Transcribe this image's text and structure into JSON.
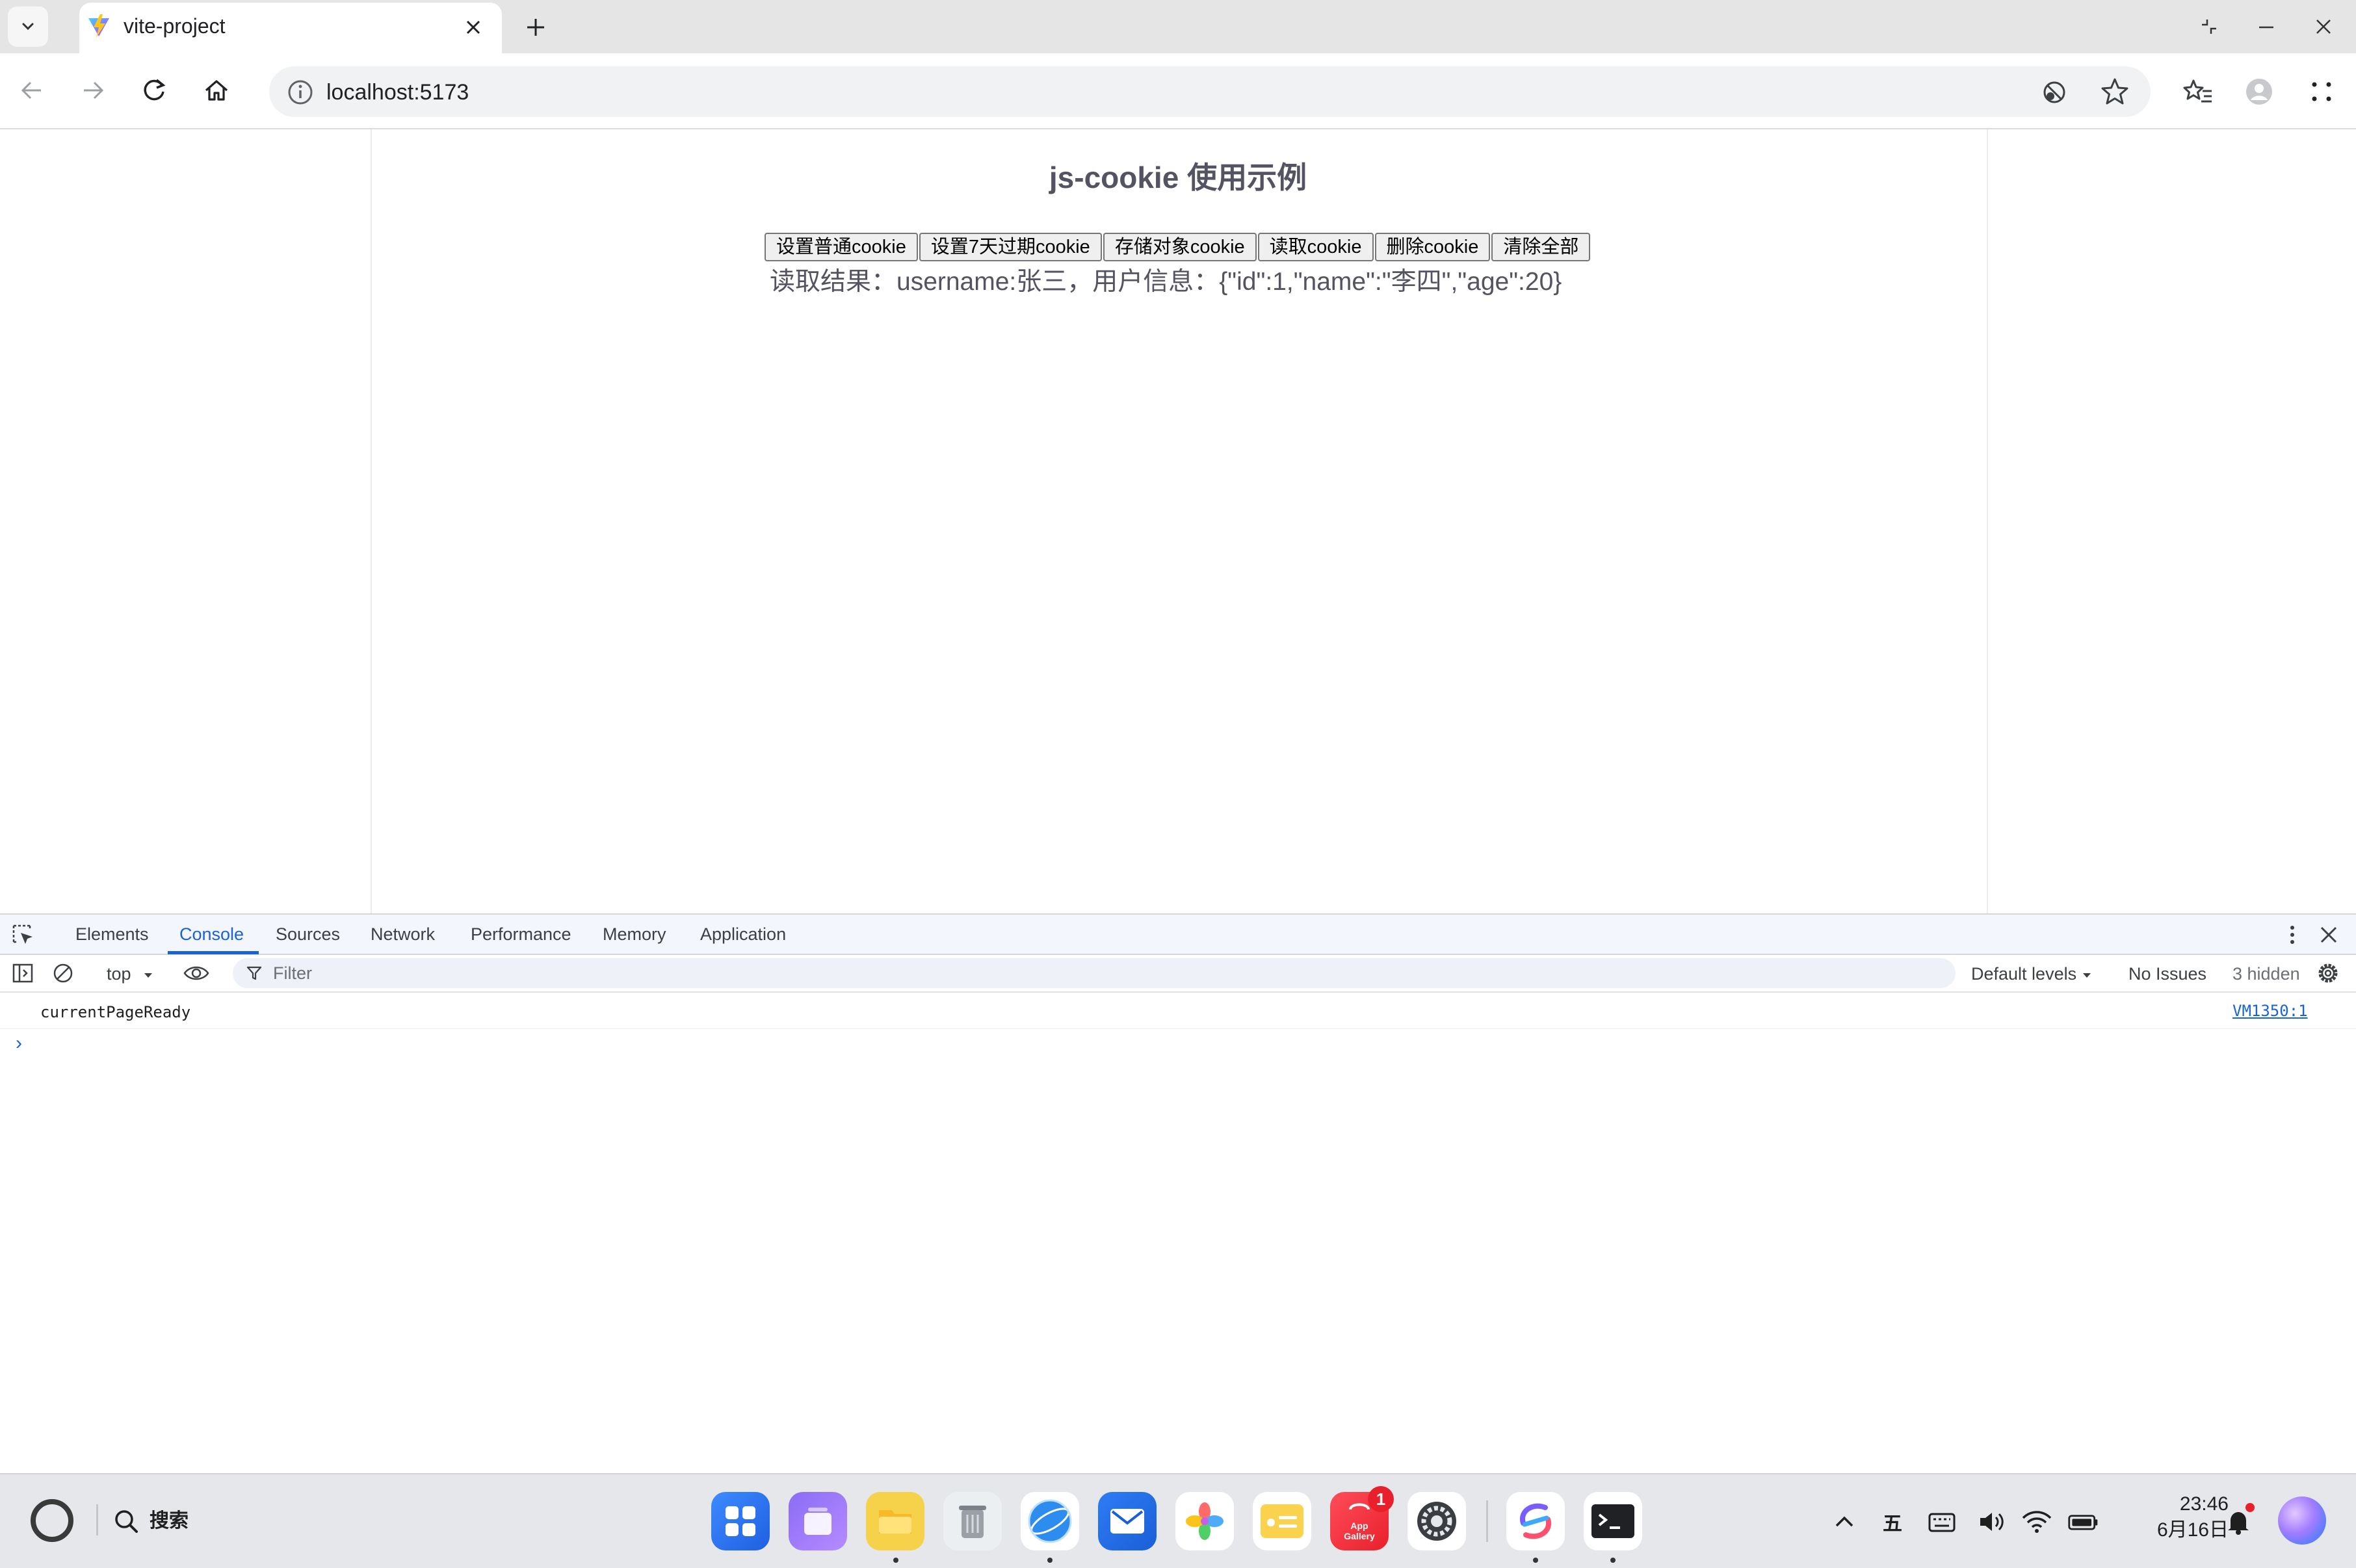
{
  "browser": {
    "tab_title": "vite-project",
    "url": "localhost:5173"
  },
  "page": {
    "heading": "js-cookie 使用示例",
    "buttons": [
      "设置普通cookie",
      "设置7天过期cookie",
      "存储对象cookie",
      "读取cookie",
      "删除cookie",
      "清除全部"
    ],
    "result_text": "读取结果：username:张三，用户信息：{\"id\":1,\"name\":\"李四\",\"age\":20}"
  },
  "devtools": {
    "tabs": [
      "Elements",
      "Console",
      "Sources",
      "Network",
      "Performance",
      "Memory",
      "Application"
    ],
    "active_tab": "Console",
    "context": "top",
    "filter_placeholder": "Filter",
    "levels": "Default levels",
    "issues": "No Issues",
    "hidden": "3 hidden",
    "messages": [
      {
        "text": "currentPageReady",
        "source": "VM1350:1"
      }
    ],
    "prompt": "›"
  },
  "taskbar": {
    "search_label": "搜索",
    "apps": [
      "launcher-icon",
      "multitask-icon",
      "files-icon",
      "trash-icon",
      "browser-icon",
      "mail-icon",
      "photos-icon",
      "notes-icon",
      "app-gallery-icon",
      "settings-icon",
      "code-editor-icon",
      "terminal-icon"
    ],
    "app_gallery_label": "App Gallery",
    "app_gallery_badge": "1",
    "ime_label": "五",
    "time": "23:46",
    "date": "6月16日"
  },
  "colors": {
    "accent": "#1a63d6",
    "heading": "#545362",
    "badge": "#e8202b"
  }
}
